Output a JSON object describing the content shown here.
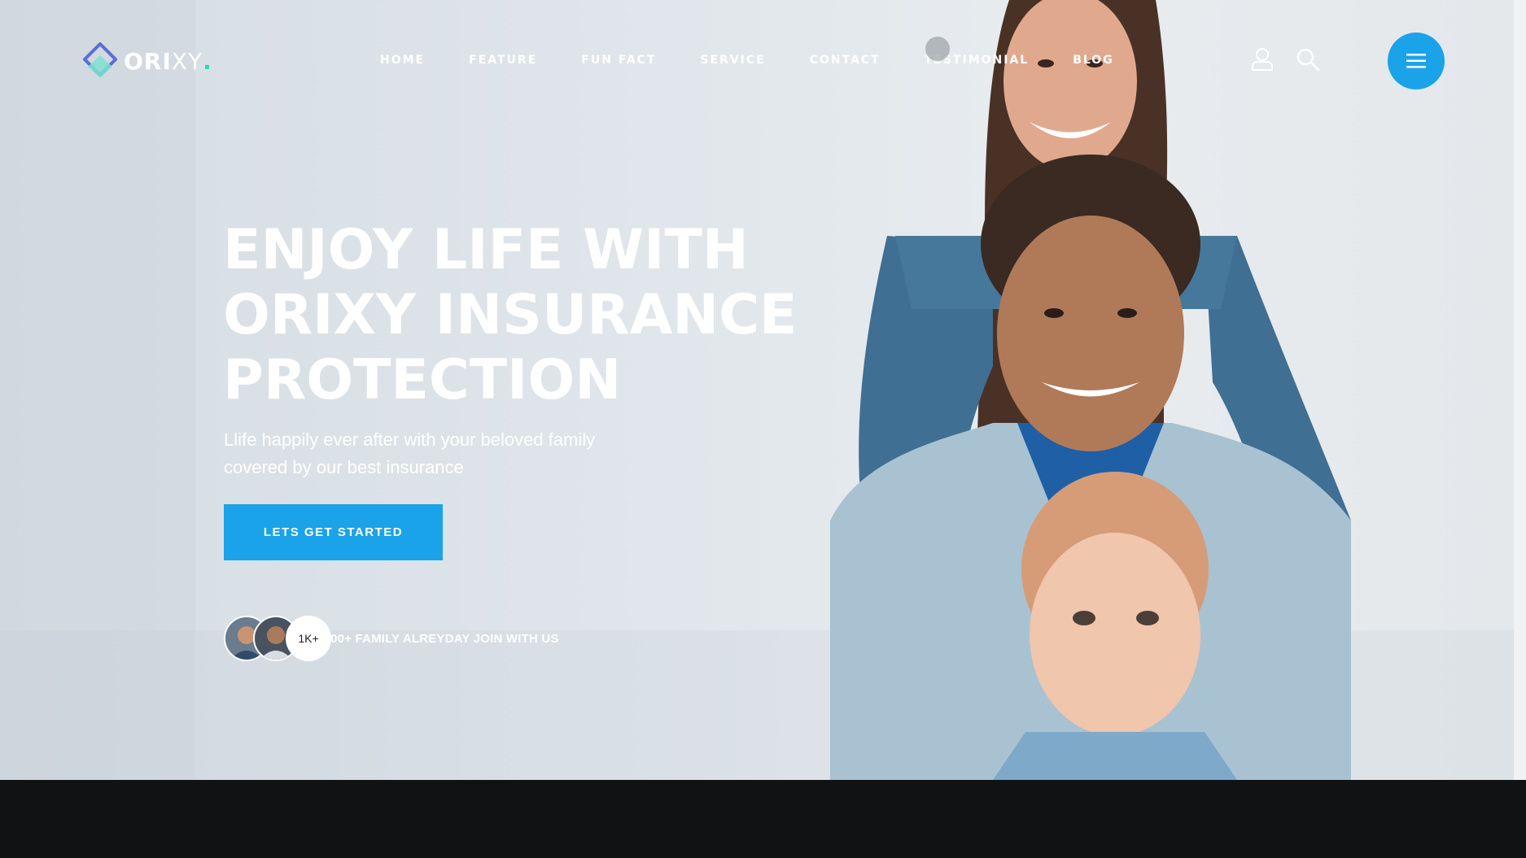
{
  "brand": {
    "name_bold": "ORI",
    "name_thin": "XY",
    "dot": "."
  },
  "nav": {
    "items": [
      "HOME",
      "FEATURE",
      "FUN FACT",
      "SERVICE",
      "CONTACT",
      "TESTIMONIAL",
      "BLOG"
    ]
  },
  "header_icons": [
    "user-icon",
    "search-icon",
    "hamburger-menu-icon"
  ],
  "hero": {
    "headline": [
      "ENJOY LIFE WITH",
      "ORIXY INSURANCE",
      "PROTECTION"
    ],
    "subtext": "Llife happily ever after with your beloved family covered by our best insurance",
    "cta_label": "LETS GET STARTED",
    "members_count": "1K+",
    "members_text": "1000+ FAMILY ALREYDAY JOIN WITH US"
  },
  "colors": {
    "accent": "#1aa3e8",
    "logo_dot": "#33d6b1",
    "footer_bg": "#111214"
  }
}
